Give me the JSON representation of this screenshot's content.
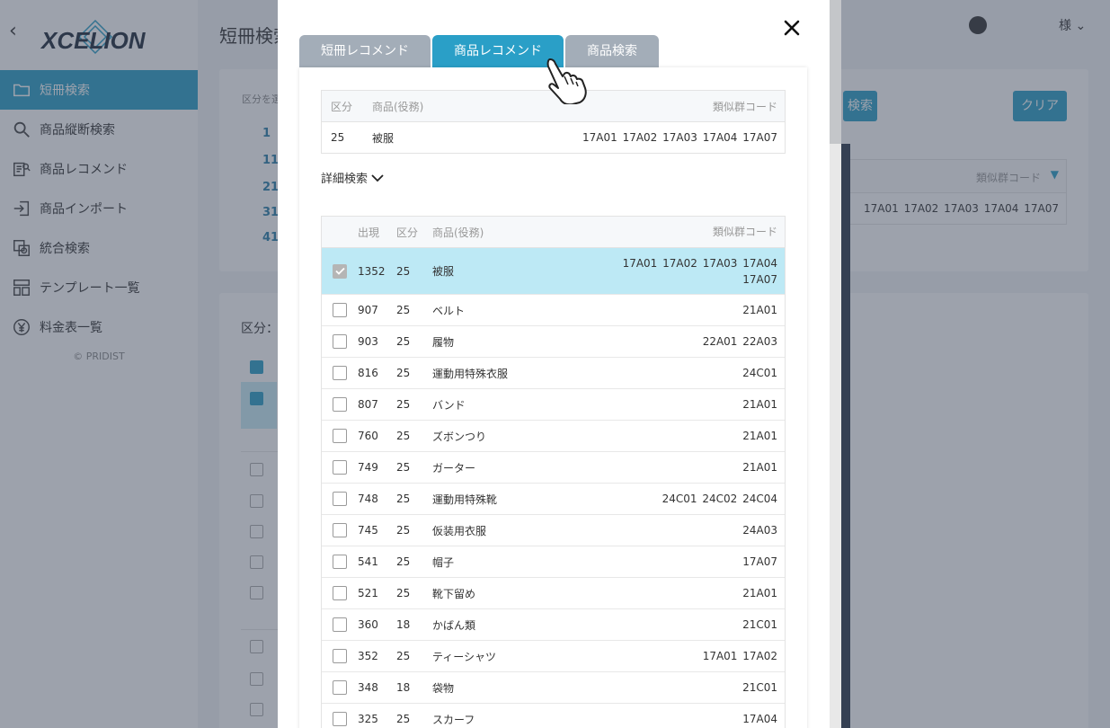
{
  "app": {
    "logo_text": "XCELION",
    "page_title": "短冊検索",
    "user_name": "様",
    "copyright": "© PRIDIST"
  },
  "sidebar": {
    "items": [
      {
        "label": "短冊検索",
        "icon": "folder-icon",
        "active": true
      },
      {
        "label": "商品縦断検索",
        "icon": "search-icon",
        "active": false
      },
      {
        "label": "商品レコメンド",
        "icon": "recommend-icon",
        "active": false
      },
      {
        "label": "商品インポート",
        "icon": "import-icon",
        "active": false
      },
      {
        "label": "統合検索",
        "icon": "integrated-search-icon",
        "active": false
      },
      {
        "label": "テンプレート一覧",
        "icon": "template-icon",
        "active": false
      },
      {
        "label": "料金表一覧",
        "icon": "yen-icon",
        "active": false
      }
    ]
  },
  "background": {
    "card1_label": "区分を選",
    "row_numbers": [
      "1",
      "11",
      "21",
      "31",
      "41"
    ],
    "search_button": "検索",
    "clear_button": "クリア",
    "table_header": "類似群コード",
    "table_row_codes": "17A01 17A02 17A03 17A04 17A07",
    "kubun_label": "区分："
  },
  "modal": {
    "close_label": "✕",
    "tabs": [
      {
        "label": "短冊レコメンド",
        "active": false
      },
      {
        "label": "商品レコメンド",
        "active": true
      },
      {
        "label": "商品検索",
        "active": false
      }
    ],
    "summary": {
      "headers": {
        "kubun": "区分",
        "item": "商品(役務)",
        "code": "類似群コード"
      },
      "row": {
        "kubun": "25",
        "item": "被服",
        "code": "17A01 17A02 17A03 17A04 17A07"
      }
    },
    "detail_search_label": "詳細検索",
    "results": {
      "headers": {
        "count": "出現",
        "kubun": "区分",
        "item": "商品(役務)",
        "code": "類似群コード"
      },
      "rows": [
        {
          "count": "1352",
          "kubun": "25",
          "item": "被服",
          "code": "17A01 17A02 17A03 17A04 17A07",
          "checked": true
        },
        {
          "count": "907",
          "kubun": "25",
          "item": "ベルト",
          "code": "21A01",
          "checked": false
        },
        {
          "count": "903",
          "kubun": "25",
          "item": "履物",
          "code": "22A01 22A03",
          "checked": false
        },
        {
          "count": "816",
          "kubun": "25",
          "item": "運動用特殊衣服",
          "code": "24C01",
          "checked": false
        },
        {
          "count": "807",
          "kubun": "25",
          "item": "バンド",
          "code": "21A01",
          "checked": false
        },
        {
          "count": "760",
          "kubun": "25",
          "item": "ズボンつり",
          "code": "21A01",
          "checked": false
        },
        {
          "count": "749",
          "kubun": "25",
          "item": "ガーター",
          "code": "21A01",
          "checked": false
        },
        {
          "count": "748",
          "kubun": "25",
          "item": "運動用特殊靴",
          "code": "24C01 24C02 24C04",
          "checked": false
        },
        {
          "count": "745",
          "kubun": "25",
          "item": "仮装用衣服",
          "code": "24A03",
          "checked": false
        },
        {
          "count": "541",
          "kubun": "25",
          "item": "帽子",
          "code": "17A07",
          "checked": false
        },
        {
          "count": "521",
          "kubun": "25",
          "item": "靴下留め",
          "code": "21A01",
          "checked": false
        },
        {
          "count": "360",
          "kubun": "18",
          "item": "かばん類",
          "code": "21C01",
          "checked": false
        },
        {
          "count": "352",
          "kubun": "25",
          "item": "ティーシャツ",
          "code": "17A01 17A02",
          "checked": false
        },
        {
          "count": "348",
          "kubun": "18",
          "item": "袋物",
          "code": "21C01",
          "checked": false
        },
        {
          "count": "325",
          "kubun": "25",
          "item": "スカーフ",
          "code": "17A04",
          "checked": false
        }
      ]
    }
  },
  "colors": {
    "accent": "#2a9fc7",
    "selected_row": "#bde9f5",
    "tab_inactive": "#a3adb8"
  }
}
